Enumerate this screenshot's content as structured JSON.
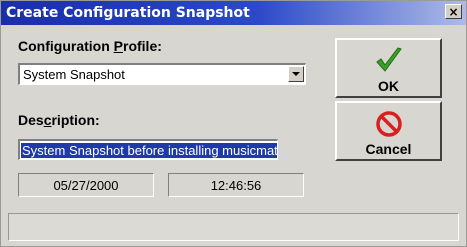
{
  "window": {
    "title": "Create Configuration Snapshot",
    "close_label": "×"
  },
  "profile": {
    "label_prefix": "Configuration ",
    "label_accel": "P",
    "label_suffix": "rofile:",
    "selected": "System Snapshot"
  },
  "description": {
    "label_prefix": "Des",
    "label_accel": "c",
    "label_suffix": "ription:",
    "value": "System Snapshot before installing musicmatch"
  },
  "status": {
    "date": "05/27/2000",
    "time": "12:46:56"
  },
  "buttons": {
    "ok_label": "OK",
    "cancel_label": "Cancel"
  },
  "colors": {
    "title_start": "#1a2ea8",
    "selection": "#1e3aa8",
    "ok_check": "#3aa028",
    "cancel_sign": "#d82020"
  },
  "icons": {
    "ok": "green-checkmark-icon",
    "cancel": "no-sign-icon"
  }
}
